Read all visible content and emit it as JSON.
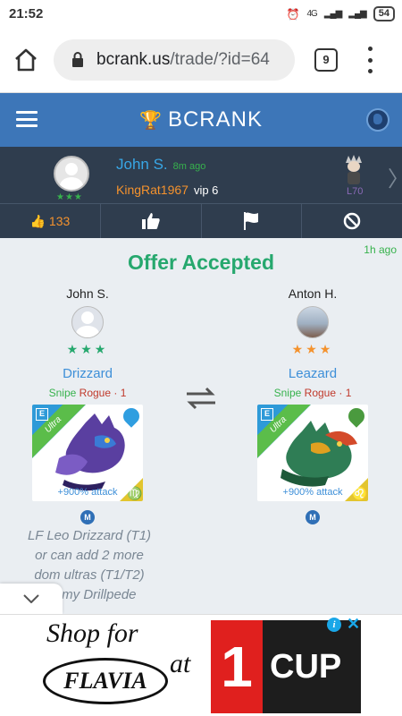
{
  "status_bar": {
    "time": "21:52",
    "network": "4G",
    "battery": "54"
  },
  "browser": {
    "url_domain": "bcrank.us",
    "url_path": "/trade/?id=64",
    "tab_count": "9"
  },
  "app_header": {
    "brand": "BCRANK"
  },
  "user_card": {
    "name": "John S.",
    "time_ago": "8m ago",
    "ign": "KingRat1967",
    "vip": "vip 6",
    "level": "L70",
    "likes": "133",
    "star_rating": "★★★"
  },
  "offer": {
    "title": "Offer Accepted",
    "time_ago": "1h ago",
    "left": {
      "trader": "John S.",
      "stars": "★★★",
      "monster_name": "Drizzard",
      "tag_snipe": "Snipe",
      "tag_rogue": "Rogue · 1",
      "rarity": "Ultra",
      "attack": "+900% attack",
      "element": "water",
      "sign": "♍",
      "badge": "M"
    },
    "right": {
      "trader": "Anton H.",
      "stars": "★★★",
      "monster_name": "Leazard",
      "tag_snipe": "Snipe",
      "tag_rogue": "Rogue · 1",
      "rarity": "Ultra",
      "attack": "+900% attack",
      "element": "nature",
      "sign": "♌",
      "badge": "M"
    },
    "note_lines": [
      "LF Leo Drizzard (T1)",
      "or can add 2 more",
      "dom ultras (T1/T2)",
      "for my Drillpede"
    ]
  },
  "ad": {
    "shop_for": "Shop for",
    "brand": "FLAVIA",
    "at": "at",
    "logo_number": "1",
    "logo_word": "CUP"
  }
}
